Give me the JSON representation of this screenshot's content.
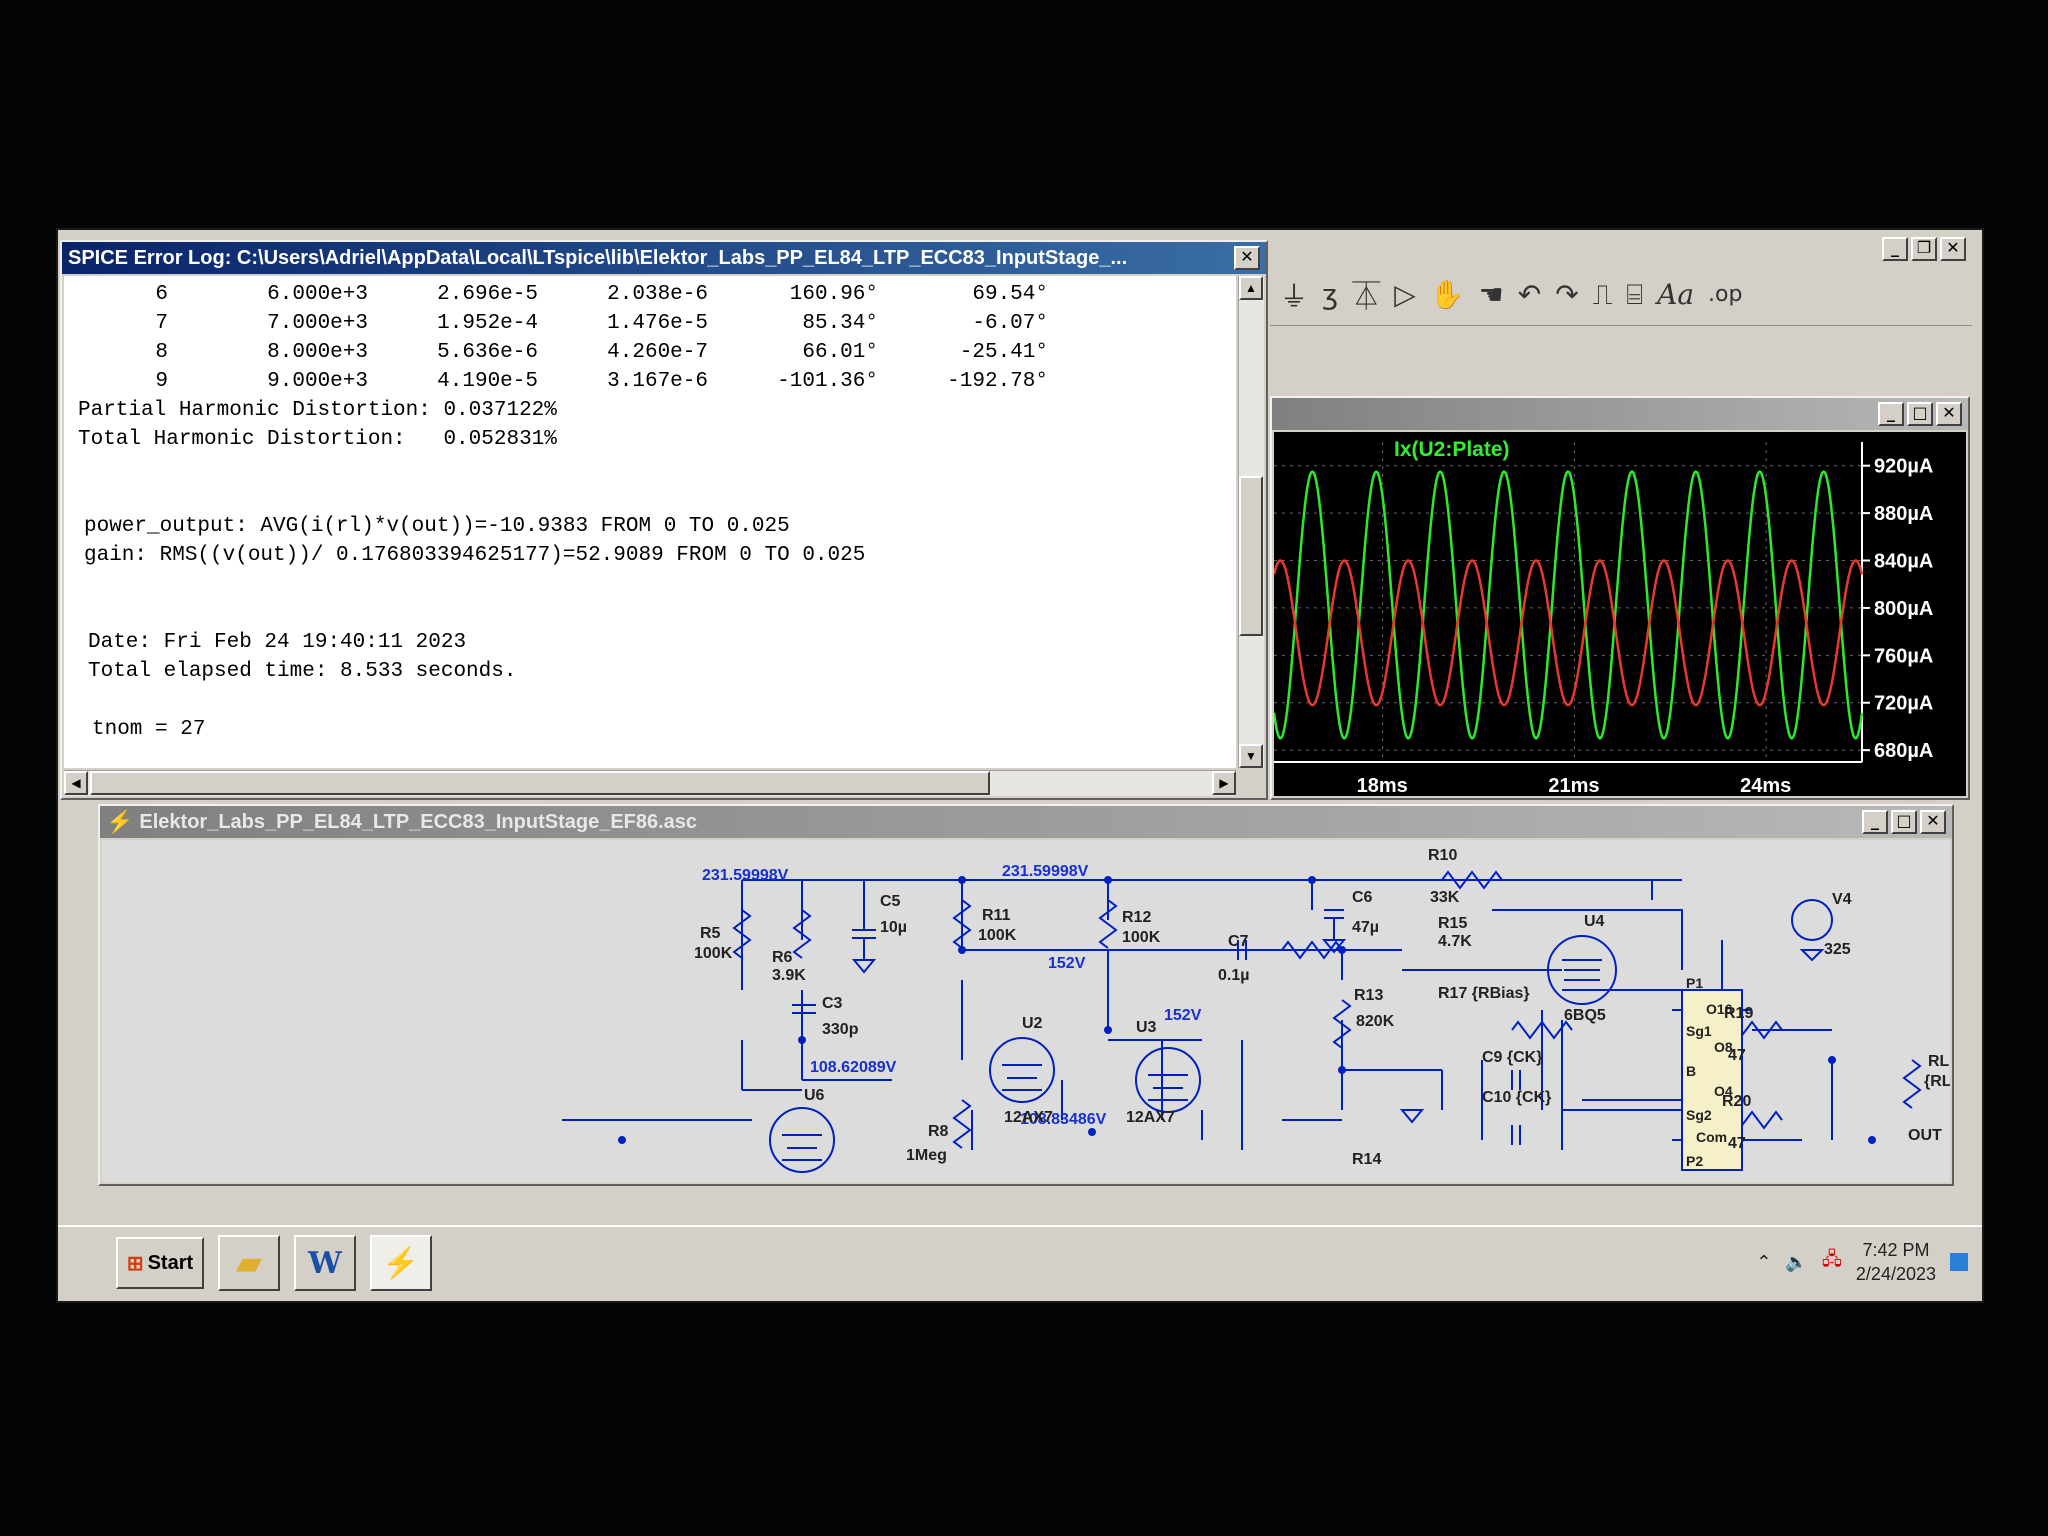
{
  "log_window": {
    "title": "SPICE Error Log: C:\\Users\\Adriel\\AppData\\Local\\LTspice\\lib\\Elektor_Labs_PP_EL84_LTP_ECC83_InputStage_...",
    "harmonics": [
      {
        "n": "6",
        "freq": "6.000e+3",
        "fourier": "2.696e-5",
        "normalized": "2.038e-6",
        "phase": "160.96°",
        "norm_phase": "69.54°"
      },
      {
        "n": "7",
        "freq": "7.000e+3",
        "fourier": "1.952e-4",
        "normalized": "1.476e-5",
        "phase": "85.34°",
        "norm_phase": "-6.07°"
      },
      {
        "n": "8",
        "freq": "8.000e+3",
        "fourier": "5.636e-6",
        "normalized": "4.260e-7",
        "phase": "66.01°",
        "norm_phase": "-25.41°"
      },
      {
        "n": "9",
        "freq": "9.000e+3",
        "fourier": "4.190e-5",
        "normalized": "3.167e-6",
        "phase": "-101.36°",
        "norm_phase": "-192.78°"
      }
    ],
    "partial_thd": "Partial Harmonic Distortion: 0.037122%",
    "total_thd": "Total Harmonic Distortion:   0.052831%",
    "power_output": "power_output: AVG(i(rl)*v(out))=-10.9383 FROM 0 TO 0.025",
    "gain": "gain: RMS((v(out))/ 0.176803394625177)=52.9089 FROM 0 TO 0.025",
    "date": "Date: Fri Feb 24 19:40:11 2023",
    "elapsed": "Total elapsed time: 8.533 seconds.",
    "tnom": "tnom = 27"
  },
  "plot_window": {
    "trace_label": "Ix(U2:Plate)",
    "colors": {
      "trace_green": "#2ee82e",
      "trace_red": "#e83a2a"
    },
    "toolbar_icons": [
      "ground-icon",
      "inductor-icon",
      "diode-icon",
      "opamp-icon",
      "hand-move-icon",
      "hand-drag-icon",
      "undo-icon",
      "redo-icon",
      "label-net-icon",
      "text-icon",
      "font-icon",
      "spice-directive-icon"
    ],
    "toolbar_labels": {
      "font": "Aa",
      "op": ".op"
    },
    "chart_data": {
      "type": "line",
      "title": "Ix(U2:Plate)",
      "xlabel": "",
      "ylabel": "",
      "xlim": [
        16.3,
        25.5
      ],
      "ylim": [
        670,
        940
      ],
      "x_ticks": [
        "18ms",
        "21ms",
        "24ms"
      ],
      "x_tick_values": [
        18,
        21,
        24
      ],
      "y_ticks": [
        "920µA",
        "880µA",
        "840µA",
        "800µA",
        "760µA",
        "720µA",
        "680µA"
      ],
      "y_tick_values": [
        920,
        880,
        840,
        800,
        760,
        720,
        680
      ],
      "grid": true,
      "series": [
        {
          "name": "Ix(U2:Plate)",
          "color": "#2ee82e",
          "frequency_khz": 1.0,
          "min": 690,
          "max": 915,
          "phase_ms": 16.9
        },
        {
          "name": "",
          "color": "#e83a2a",
          "frequency_khz": 1.0,
          "min": 718,
          "max": 840,
          "phase_ms": 17.4
        }
      ]
    }
  },
  "schematic_window": {
    "title": "Elektor_Labs_PP_EL84_LTP_ECC83_InputStage_EF86.asc",
    "labels": {
      "v1": "231.59998V",
      "v2": "231.59998V",
      "v3": "152V",
      "v4": "152V",
      "v5": "108.62089V",
      "v6": "108.83486V",
      "r5": "R5",
      "r5v": "100K",
      "r6": "R6",
      "r6v": "3.9K",
      "c5": "C5",
      "c5v": "10µ",
      "c3": "C3",
      "c3v": "330p",
      "r11": "R11",
      "r11v": "100K",
      "r12": "R12",
      "r12v": "100K",
      "c7": "C7",
      "c7v": "0.1µ",
      "c6": "C6",
      "c6v": "47µ",
      "r10": "R10",
      "r10v": "33K",
      "r15": "R15",
      "r15v": "4.7K",
      "r13": "R13",
      "r13v": "820K",
      "r17": "R17 {RBias}",
      "c9": "C9 {CK}",
      "c10": "C10 {CK}",
      "r14": "R14",
      "u2": "U2",
      "u3": "U3",
      "u6": "U6",
      "u4": "U4",
      "t2": "12AX7",
      "t3": "12AX7",
      "t4": "6BQ5",
      "r8": "R8",
      "r8v": "1Meg",
      "v4n": "V4",
      "v4v": "325",
      "r19": "R19",
      "r19v": "47",
      "r20": "R20",
      "r20v": "47",
      "p1": "P1",
      "p2": "P2",
      "o16": "O16",
      "sg1": "Sg1",
      "o8": "O8",
      "b": "B",
      "o4": "O4",
      "sg2": "Sg2",
      "com": "Com",
      "rl": "RL",
      "rlv": "{RLoad}",
      "out": "OUT"
    }
  },
  "taskbar": {
    "start_label": "Start",
    "time": "7:42 PM",
    "date": "2/24/2023"
  }
}
